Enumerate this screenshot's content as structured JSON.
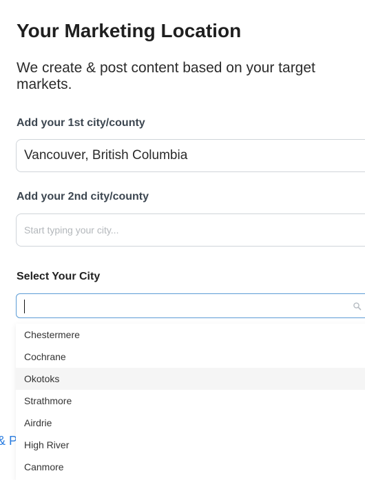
{
  "page": {
    "title": "Your Marketing Location",
    "subtitle": "We create & post content based on your target markets."
  },
  "city1": {
    "label": "Add your 1st city/county",
    "value": "Vancouver, British Columbia"
  },
  "city2": {
    "label": "Add your 2nd city/county",
    "value": "",
    "placeholder": "Start typing your city..."
  },
  "select_city": {
    "label": "Select Your City",
    "search_value": "",
    "search_icon": "search-icon",
    "options": [
      {
        "label": "Chestermere"
      },
      {
        "label": "Cochrane"
      },
      {
        "label": "Okotoks"
      },
      {
        "label": "Strathmore"
      },
      {
        "label": "Airdrie"
      },
      {
        "label": "High River"
      },
      {
        "label": "Canmore"
      }
    ],
    "highlighted_option": "Okotoks"
  },
  "background": {
    "partial_link": "& P"
  },
  "colors": {
    "focus_border": "#5b9bd5",
    "link": "#2a7de1",
    "highlight_row": "#f5f5f5"
  }
}
